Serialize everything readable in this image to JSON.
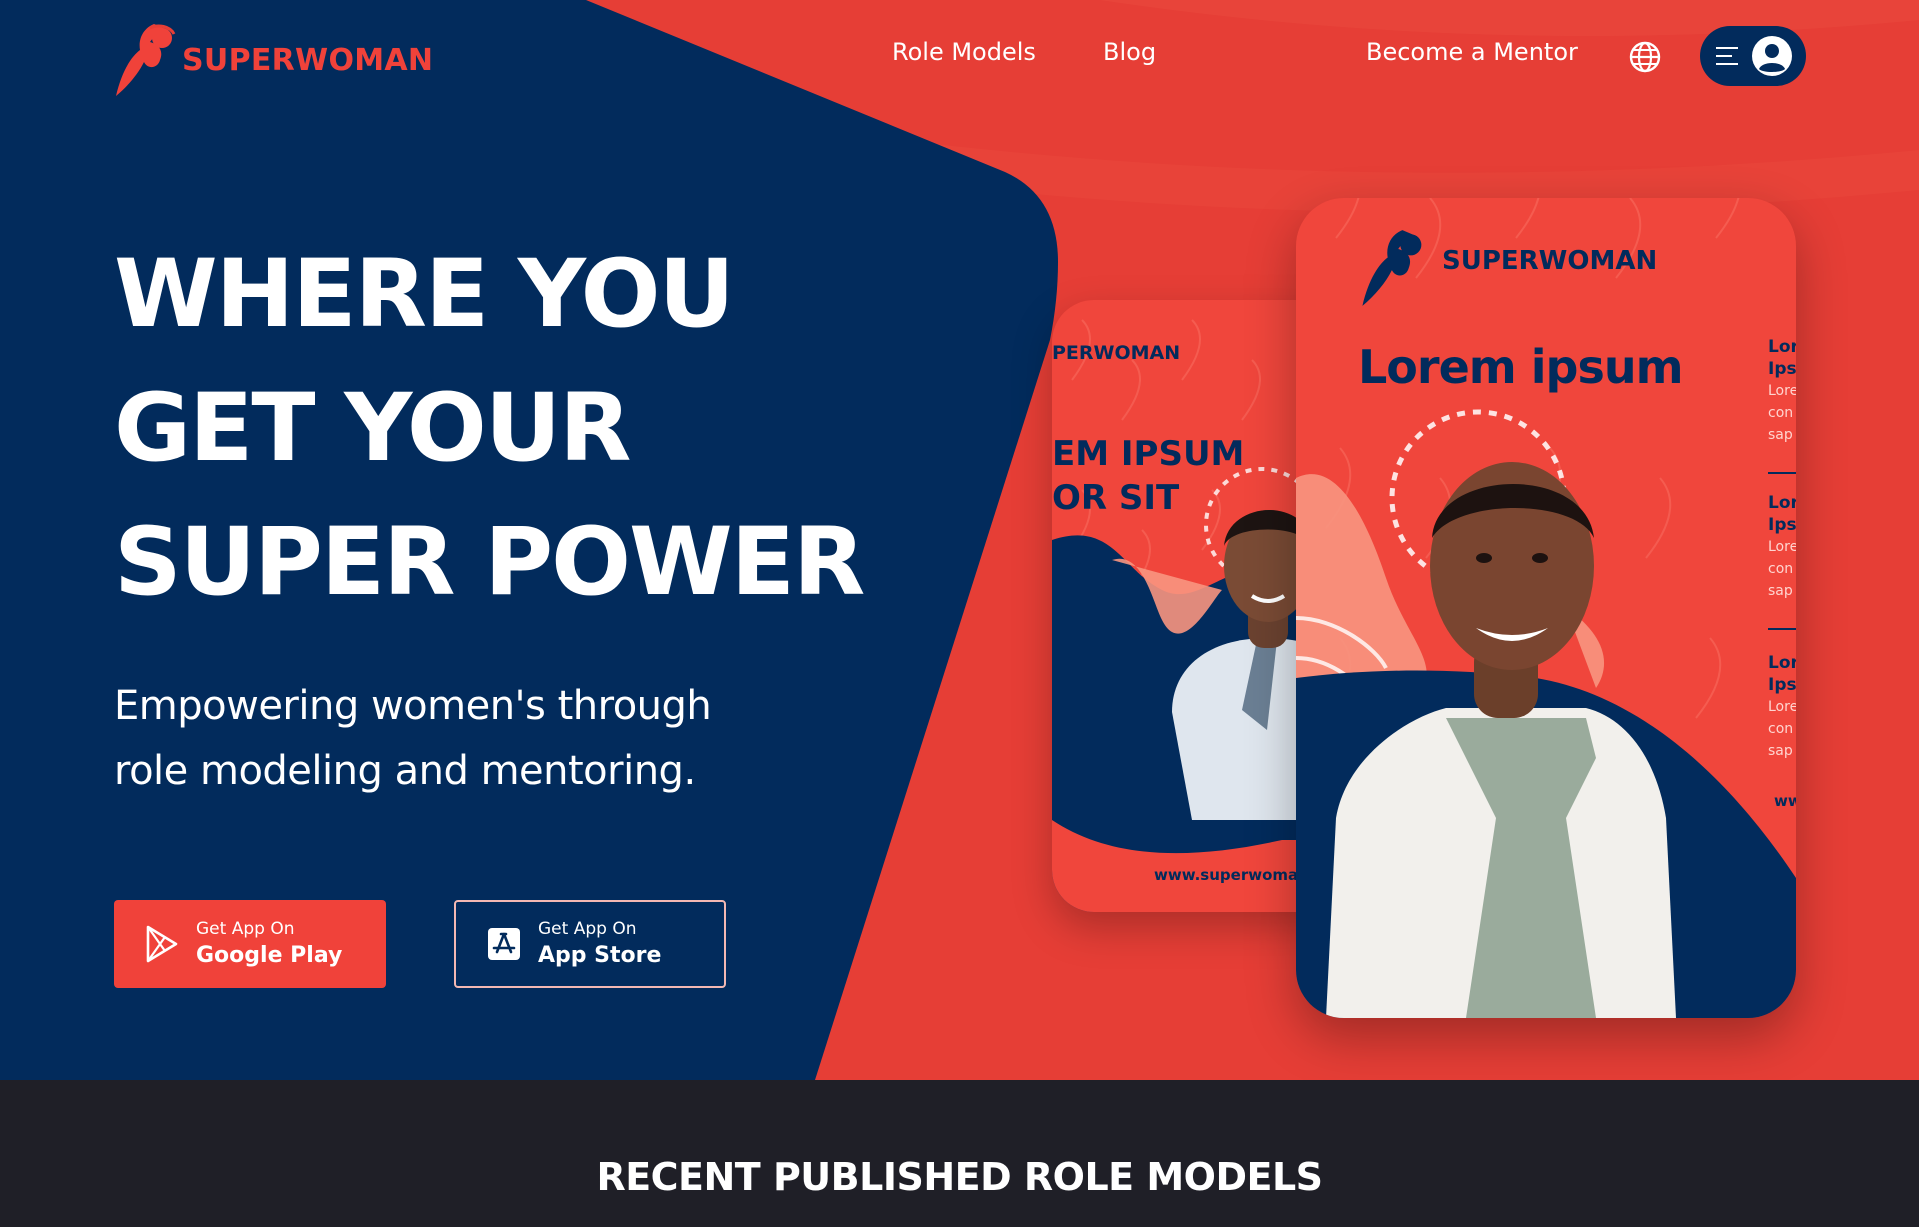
{
  "brand": {
    "name": "SUPERWOMAN"
  },
  "nav": {
    "role_models": "Role Models",
    "blog": "Blog",
    "become_mentor": "Become a Mentor"
  },
  "hero": {
    "headline": [
      "WHERE YOU",
      "GET YOUR",
      "SUPER POWER"
    ],
    "subline": [
      "Empowering women's through",
      "role modeling and mentoring."
    ]
  },
  "buttons": {
    "google": {
      "small": "Get App On",
      "big": "Google Play"
    },
    "apple": {
      "small": "Get App On",
      "big": "App Store"
    }
  },
  "card_back": {
    "brand": "PERWOMAN",
    "title": [
      "EM IPSUM",
      "OR SIT"
    ],
    "url": "www.superwoma"
  },
  "card_front": {
    "brand": "SUPERWOMAN",
    "title": "Lorem ipsum",
    "side": [
      {
        "h1": "Lor",
        "h2": "Ips",
        "p1": "Lore",
        "p2": "con",
        "p3": "sap"
      },
      {
        "h1": "Lor",
        "h2": "Ips",
        "p1": "Lore",
        "p2": "con",
        "p3": "sap"
      },
      {
        "h1": "Lor",
        "h2": "Ips",
        "p1": "Lore",
        "p2": "con",
        "p3": "sap"
      }
    ],
    "url": "ww"
  },
  "section": {
    "title": "RECENT PUBLISHED ROLE MODELS"
  },
  "colors": {
    "navy": "#022b5c",
    "red": "#e63e36",
    "accent_red": "#f0423a",
    "dark": "#1f1f27"
  },
  "icons": {
    "globe": "globe-icon",
    "menu": "hamburger-menu-icon",
    "user": "user-avatar-icon",
    "google_play": "google-play-icon",
    "app_store": "app-store-icon"
  }
}
